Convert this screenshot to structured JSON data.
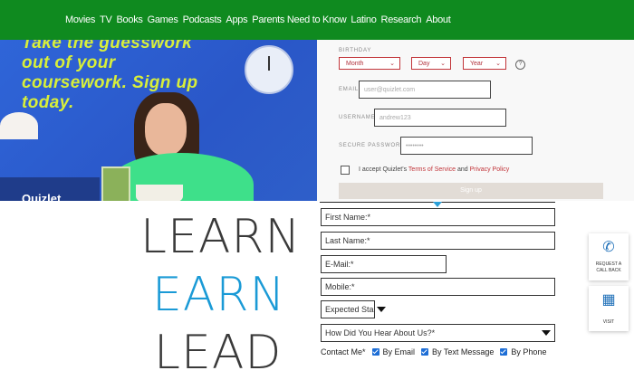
{
  "nav": {
    "items": [
      "Movies",
      "TV",
      "Books",
      "Games",
      "Podcasts",
      "Apps",
      "Parents Need to Know",
      "Latino",
      "Research",
      "About"
    ]
  },
  "hero": {
    "headline": "Take the guesswork out of your coursework. Sign up today.",
    "brand": "Quizlet"
  },
  "signup": {
    "birthday_label": "BIRTHDAY",
    "month": "Month",
    "day": "Day",
    "year": "Year",
    "help": "?",
    "email_label": "EMAIL",
    "email_placeholder": "user@quizlet.com",
    "username_label": "USERNAME",
    "username_placeholder": "andrew123",
    "password_label": "SECURE PASSWORD",
    "password_placeholder": "••••••••",
    "accept_text": "I accept Quizlet's",
    "terms_link": "Terms of Service",
    "and_text": "and",
    "privacy_link": "Privacy Policy",
    "button": "Sign up"
  },
  "slogan": {
    "learn": "LEARN",
    "earn": "EARN",
    "lead": "LEAD"
  },
  "contact_form": {
    "first_name": "First Name:*",
    "last_name": "Last Name:*",
    "email": "E-Mail:*",
    "mobile": "Mobile:*",
    "start": "Expected Start Y",
    "hear": "How Did You Hear About Us?*",
    "contact_label": "Contact Me*",
    "options": [
      "By Email",
      "By Text Message",
      "By Phone"
    ]
  },
  "widgets": {
    "callback": "REQUEST A CALL BACK",
    "visit": "VISIT"
  },
  "colors": {
    "nav_green": "#0f8a1f",
    "earn_blue": "#1a9ad6",
    "slogan_dark": "#3a3a3a",
    "quizlet_red": "#c2353a"
  }
}
